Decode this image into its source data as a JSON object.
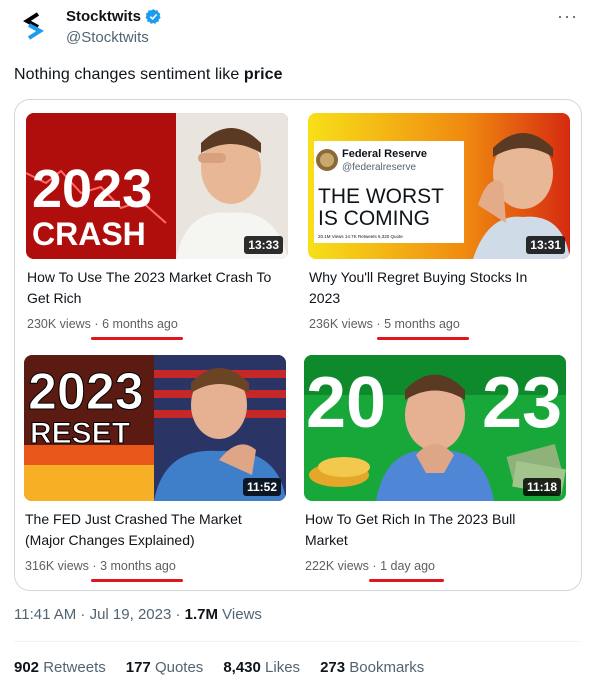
{
  "header": {
    "name": "Stocktwits",
    "handle": "@Stocktwits",
    "more_icon": "ellipsis-icon"
  },
  "tweet": {
    "text_plain": "Nothing changes sentiment like ",
    "text_bold": "price"
  },
  "videos": [
    {
      "title": "How To Use The 2023 Market Crash To Get Rich",
      "views": "230K views",
      "age": "6 months ago",
      "duration": "13:33",
      "thumb_big": "2023",
      "thumb_word": "CRASH"
    },
    {
      "title": "Why You'll Regret Buying Stocks In 2023",
      "views": "236K views",
      "age": "5 months ago",
      "duration": "13:31",
      "thumb_account": "Federal Reserve",
      "thumb_handle": "@federalreserve",
      "thumb_line1": "THE WORST",
      "thumb_line2": "IS COMING",
      "thumb_stats": "20.1M Views   14.7K Retweets   6,320 Quote"
    },
    {
      "title": "The FED Just Crashed The Market (Major Changes Explained)",
      "views": "316K views",
      "age": "3 months ago",
      "duration": "11:52",
      "thumb_big": "2023",
      "thumb_word": "RESET"
    },
    {
      "title": "How To Get Rich In The 2023 Bull Market",
      "views": "222K views",
      "age": "1 day ago",
      "duration": "11:18",
      "thumb_left": "20",
      "thumb_right": "23"
    }
  ],
  "footer": {
    "time": "11:41 AM · Jul 19, 2023 · ",
    "views_count": "1.7M",
    "views_label": " Views",
    "stats": [
      {
        "count": "902",
        "label": "Retweets"
      },
      {
        "count": "177",
        "label": "Quotes"
      },
      {
        "count": "8,430",
        "label": "Likes"
      },
      {
        "count": "273",
        "label": "Bookmarks"
      }
    ]
  },
  "colors": {
    "verified": "#1d9bf0",
    "underline": "#e0161f",
    "secondary_text": "#536471"
  }
}
